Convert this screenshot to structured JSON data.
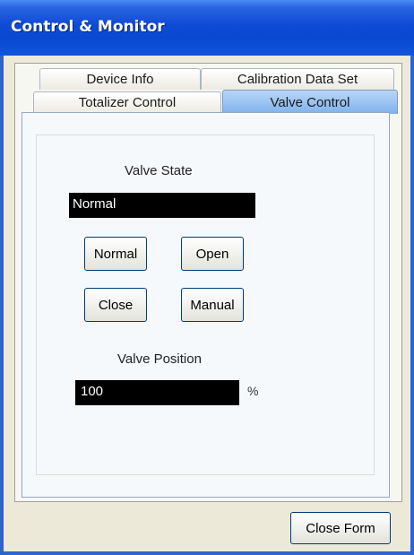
{
  "window": {
    "title": "Control & Monitor"
  },
  "tabs": {
    "row_back": [
      {
        "label": "Device Info"
      },
      {
        "label": "Calibration Data Set"
      }
    ],
    "row_front": [
      {
        "label": "Totalizer Control"
      },
      {
        "label": "Valve Control"
      }
    ],
    "active": "Valve Control"
  },
  "valve_state": {
    "label": "Valve State",
    "value": "Normal",
    "buttons": {
      "normal": "Normal",
      "open": "Open",
      "close": "Close",
      "manual": "Manual"
    }
  },
  "valve_position": {
    "label": "Valve Position",
    "value": "100",
    "unit": "%"
  },
  "footer": {
    "close_form": "Close Form"
  },
  "colors": {
    "title_bar": "#0b48d1",
    "active_tab": "#7eb2ec",
    "display_bg": "#000000"
  }
}
